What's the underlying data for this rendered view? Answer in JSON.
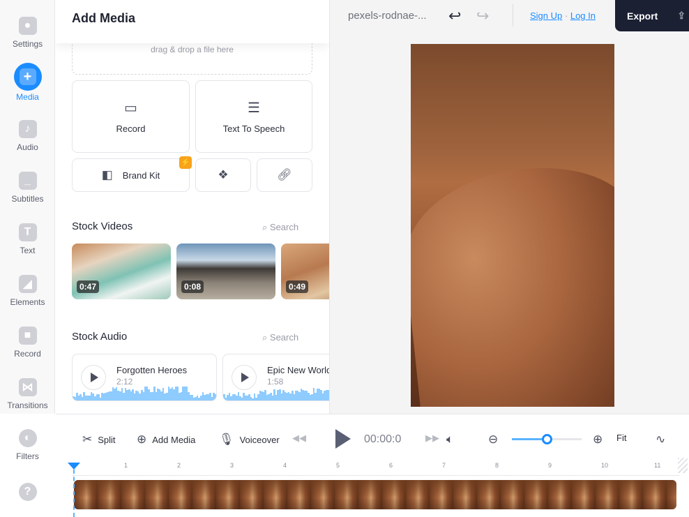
{
  "sidebar": {
    "items": [
      {
        "label": "Settings",
        "icon": "gear-icon"
      },
      {
        "label": "Media",
        "icon": "plus-icon",
        "active": true
      },
      {
        "label": "Audio",
        "icon": "music-note-icon"
      },
      {
        "label": "Subtitles",
        "icon": "subtitles-icon"
      },
      {
        "label": "Text",
        "icon": "text-icon"
      },
      {
        "label": "Elements",
        "icon": "elements-icon"
      },
      {
        "label": "Record",
        "icon": "camera-icon"
      },
      {
        "label": "Transitions",
        "icon": "transitions-icon"
      },
      {
        "label": "Filters",
        "icon": "filters-icon"
      }
    ],
    "help_icon": "help-icon"
  },
  "panel": {
    "title": "Add Media",
    "drop_text": "drag & drop a file here",
    "record_label": "Record",
    "tts_label": "Text To Speech",
    "brand_kit_label": "Brand Kit",
    "stock_videos": {
      "title": "Stock Videos",
      "search": "Search",
      "items": [
        {
          "duration": "0:47"
        },
        {
          "duration": "0:08"
        },
        {
          "duration": "0:49"
        }
      ]
    },
    "stock_audio": {
      "title": "Stock Audio",
      "search": "Search",
      "items": [
        {
          "name": "Forgotten Heroes",
          "duration": "2:12"
        },
        {
          "name": "Epic New World",
          "duration": "1:58"
        }
      ]
    }
  },
  "header": {
    "filename": "pexels-rodnae-...",
    "sign_up": "Sign Up",
    "separator": "·",
    "log_in": "Log In",
    "export_label": "Export"
  },
  "toolbar": {
    "split": "Split",
    "add_media": "Add Media",
    "voiceover": "Voiceover",
    "time": "00:00:0",
    "fit": "Fit",
    "zoom_level": 0.5
  },
  "timeline": {
    "ticks": [
      "1",
      "2",
      "3",
      "4",
      "5",
      "6",
      "7",
      "8",
      "9",
      "10",
      "11"
    ]
  },
  "colors": {
    "accent": "#1a8cff",
    "export_bg": "#1b2033",
    "badge": "#f7a31b"
  }
}
